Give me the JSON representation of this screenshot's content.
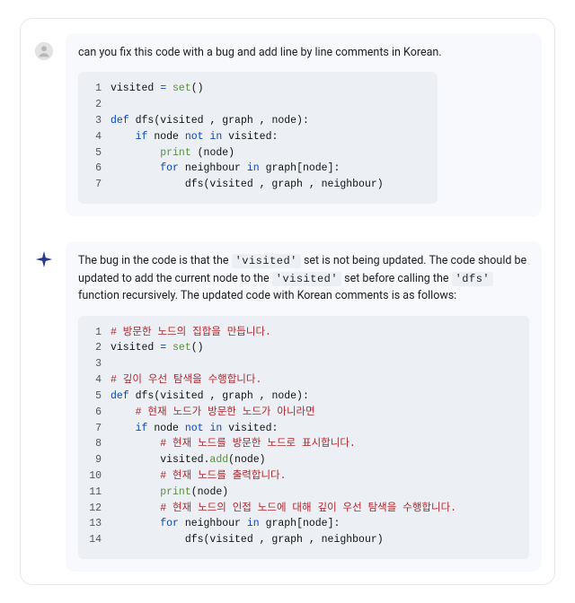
{
  "user": {
    "prompt": "can you fix this code with a bug and add line by line comments in Korean.",
    "code": {
      "lines": [
        {
          "n": 1,
          "segs": [
            {
              "t": "visited "
            },
            {
              "t": "=",
              "c": "kw"
            },
            {
              "t": " "
            },
            {
              "t": "set",
              "c": "fn"
            },
            {
              "t": "()"
            }
          ]
        },
        {
          "n": 2,
          "segs": []
        },
        {
          "n": 3,
          "segs": [
            {
              "t": "def ",
              "c": "kw"
            },
            {
              "t": "dfs",
              "c": ""
            },
            {
              "t": "(visited , graph , node):"
            }
          ]
        },
        {
          "n": 4,
          "segs": [
            {
              "t": "    "
            },
            {
              "t": "if ",
              "c": "kw"
            },
            {
              "t": "node "
            },
            {
              "t": "not in ",
              "c": "kw"
            },
            {
              "t": "visited:"
            }
          ]
        },
        {
          "n": 5,
          "segs": [
            {
              "t": "        "
            },
            {
              "t": "print",
              "c": "fn"
            },
            {
              "t": " (node)"
            }
          ]
        },
        {
          "n": 6,
          "segs": [
            {
              "t": "        "
            },
            {
              "t": "for ",
              "c": "kw"
            },
            {
              "t": "neighbour "
            },
            {
              "t": "in ",
              "c": "kw"
            },
            {
              "t": "graph[node]:"
            }
          ]
        },
        {
          "n": 7,
          "segs": [
            {
              "t": "            dfs(visited , graph , neighbour)"
            }
          ]
        }
      ]
    }
  },
  "ai": {
    "text_parts": [
      "The bug in the code is that the ",
      " set is not being updated. The code should be updated to add the current node to the ",
      " set before calling the ",
      " function recursively. The updated code with Korean comments is as follows:"
    ],
    "inline_codes": [
      "'visited'",
      "'visited'",
      "'dfs'"
    ],
    "code": {
      "lines": [
        {
          "n": 1,
          "segs": [
            {
              "t": "# 방문한 노드의 집합을 만듭니다.",
              "c": "cm"
            }
          ]
        },
        {
          "n": 2,
          "segs": [
            {
              "t": "visited "
            },
            {
              "t": "=",
              "c": "kw"
            },
            {
              "t": " "
            },
            {
              "t": "set",
              "c": "fn"
            },
            {
              "t": "()"
            }
          ]
        },
        {
          "n": 3,
          "segs": []
        },
        {
          "n": 4,
          "segs": [
            {
              "t": "# 깊이 우선 탐색을 수행합니다.",
              "c": "cm"
            }
          ]
        },
        {
          "n": 5,
          "segs": [
            {
              "t": "def ",
              "c": "kw"
            },
            {
              "t": "dfs"
            },
            {
              "t": "(visited , graph , node):"
            }
          ]
        },
        {
          "n": 6,
          "segs": [
            {
              "t": "    "
            },
            {
              "t": "# 현재 노드가 방문한 노드가 아니라면",
              "c": "cm"
            }
          ]
        },
        {
          "n": 7,
          "segs": [
            {
              "t": "    "
            },
            {
              "t": "if ",
              "c": "kw"
            },
            {
              "t": "node "
            },
            {
              "t": "not in ",
              "c": "kw"
            },
            {
              "t": "visited:"
            }
          ]
        },
        {
          "n": 8,
          "segs": [
            {
              "t": "        "
            },
            {
              "t": "# 현재 노드를 방문한 노드로 표시합니다.",
              "c": "cm"
            }
          ]
        },
        {
          "n": 9,
          "segs": [
            {
              "t": "        visited."
            },
            {
              "t": "add",
              "c": "fn"
            },
            {
              "t": "(node)"
            }
          ]
        },
        {
          "n": 10,
          "segs": [
            {
              "t": "        "
            },
            {
              "t": "# 현재 노드를 출력합니다.",
              "c": "cm"
            }
          ]
        },
        {
          "n": 11,
          "segs": [
            {
              "t": "        "
            },
            {
              "t": "print",
              "c": "fn"
            },
            {
              "t": "(node)"
            }
          ]
        },
        {
          "n": 12,
          "segs": [
            {
              "t": "        "
            },
            {
              "t": "# 현재 노드의 인접 노드에 대해 깊이 우선 탐색을 수행합니다.",
              "c": "cm"
            }
          ]
        },
        {
          "n": 13,
          "segs": [
            {
              "t": "        "
            },
            {
              "t": "for ",
              "c": "kw"
            },
            {
              "t": "neighbour "
            },
            {
              "t": "in ",
              "c": "kw"
            },
            {
              "t": "graph[node]:"
            }
          ]
        },
        {
          "n": 14,
          "segs": [
            {
              "t": "            dfs(visited , graph , neighbour)"
            }
          ]
        }
      ]
    }
  }
}
